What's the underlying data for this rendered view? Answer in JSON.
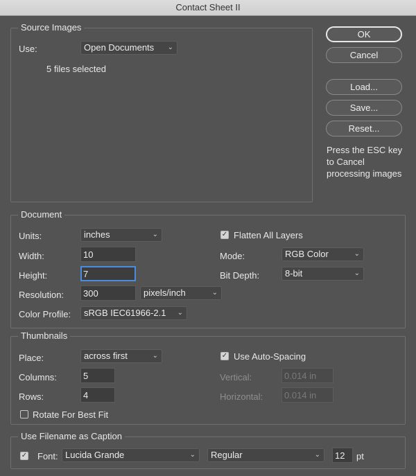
{
  "window": {
    "title": "Contact Sheet II"
  },
  "buttons": {
    "ok": "OK",
    "cancel": "Cancel",
    "load": "Load...",
    "save": "Save...",
    "reset": "Reset..."
  },
  "hint": "Press the ESC key to Cancel processing images",
  "source_images": {
    "legend": "Source Images",
    "use_label": "Use:",
    "use_value": "Open Documents",
    "files_selected": "5 files selected"
  },
  "document": {
    "legend": "Document",
    "units_label": "Units:",
    "units_value": "inches",
    "width_label": "Width:",
    "width_value": "10",
    "height_label": "Height:",
    "height_value": "7",
    "resolution_label": "Resolution:",
    "resolution_value": "300",
    "resolution_unit": "pixels/inch",
    "color_profile_label": "Color Profile:",
    "color_profile_value": "sRGB IEC61966-2.1",
    "flatten_label": "Flatten All Layers",
    "flatten_checked": true,
    "mode_label": "Mode:",
    "mode_value": "RGB Color",
    "bit_depth_label": "Bit Depth:",
    "bit_depth_value": "8-bit"
  },
  "thumbnails": {
    "legend": "Thumbnails",
    "place_label": "Place:",
    "place_value": "across first",
    "columns_label": "Columns:",
    "columns_value": "5",
    "rows_label": "Rows:",
    "rows_value": "4",
    "rotate_label": "Rotate For Best Fit",
    "rotate_checked": false,
    "auto_spacing_label": "Use Auto-Spacing",
    "auto_spacing_checked": true,
    "vertical_label": "Vertical:",
    "vertical_value": "0.014 in",
    "horizontal_label": "Horizontal:",
    "horizontal_value": "0.014 in"
  },
  "caption": {
    "legend": "Use Filename as Caption",
    "enabled": true,
    "font_label": "Font:",
    "font_value": "Lucida Grande",
    "style_value": "Regular",
    "size_value": "12",
    "size_unit": "pt"
  },
  "icons": {
    "dropdown": "chevron-down-icon",
    "check": "checkmark-icon"
  }
}
